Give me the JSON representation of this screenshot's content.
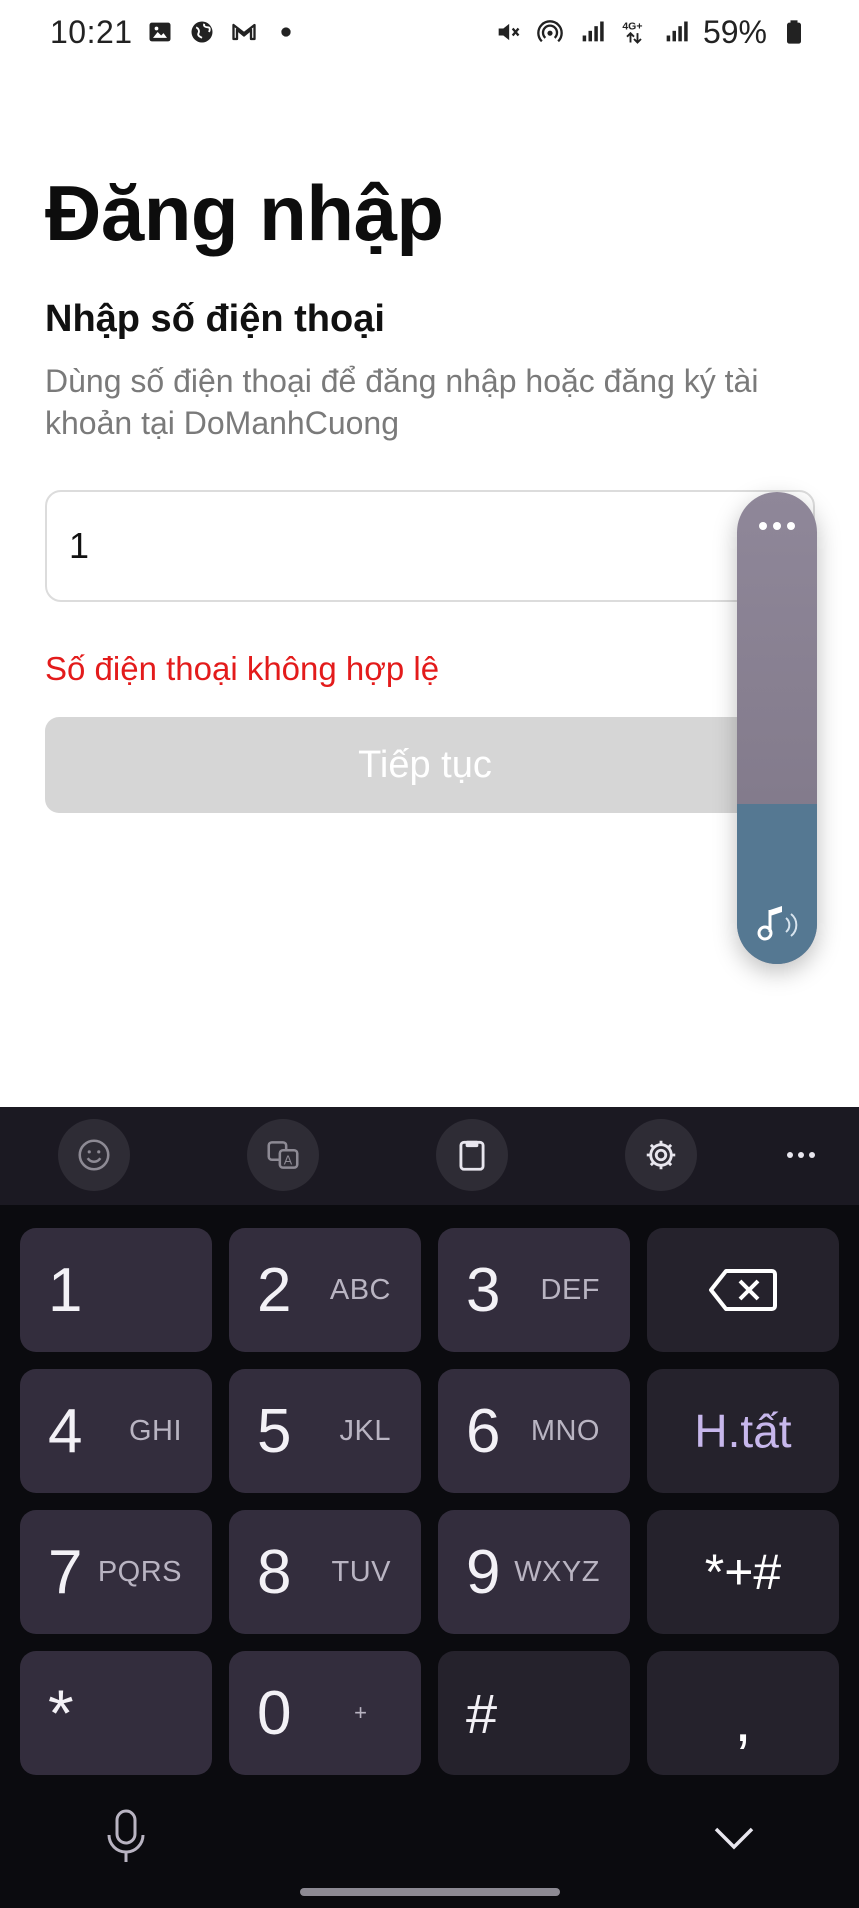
{
  "status_bar": {
    "time": "10:21",
    "left_icons": [
      "gallery-icon",
      "globe-icon",
      "gmail-icon",
      "dot-icon"
    ],
    "right_icons": [
      "mute-icon",
      "hotspot-icon",
      "signal-icon",
      "network-4g-icon",
      "signal-icon-2",
      "battery-icon"
    ],
    "network": "4G+",
    "battery": "59%"
  },
  "login": {
    "title": "Đăng nhập",
    "section_title": "Nhập số điện thoại",
    "description": "Dùng số điện thoại để đăng nhập hoặc đăng ký tài khoản tại DoManhCuong",
    "phone_value": "1",
    "error": "Số điện thoại không hợp lệ",
    "continue_label": "Tiếp tục"
  },
  "volume_panel": {
    "level": 0.34,
    "icon": "music-note-icon"
  },
  "keyboard": {
    "toolbar": [
      "emoji-icon",
      "translate-icon",
      "clipboard-icon",
      "settings-icon",
      "more-icon"
    ],
    "keys": {
      "k1": {
        "digit": "1",
        "letters": ""
      },
      "k2": {
        "digit": "2",
        "letters": "ABC"
      },
      "k3": {
        "digit": "3",
        "letters": "DEF"
      },
      "k4": {
        "digit": "4",
        "letters": "GHI"
      },
      "k5": {
        "digit": "5",
        "letters": "JKL"
      },
      "k6": {
        "digit": "6",
        "letters": "MNO"
      },
      "k7": {
        "digit": "7",
        "letters": "PQRS"
      },
      "k8": {
        "digit": "8",
        "letters": "TUV"
      },
      "k9": {
        "digit": "9",
        "letters": "WXYZ"
      },
      "k0": {
        "digit": "0",
        "letters": "+"
      },
      "star": "*",
      "hash": "#",
      "done": "H.tất",
      "symbols": "*+#",
      "comma": ","
    },
    "colors": {
      "key": "#332d3d",
      "func_key": "#25222c",
      "accent": "#c7b7ec"
    }
  }
}
